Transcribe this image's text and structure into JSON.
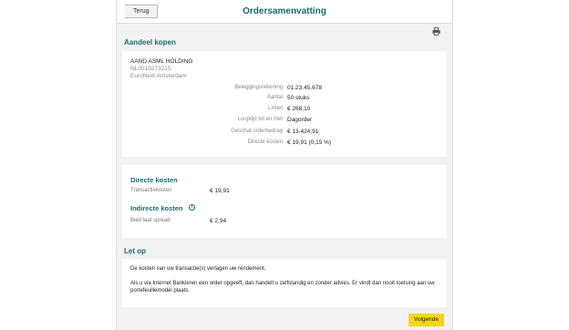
{
  "header": {
    "back_label": "Terug",
    "title": "Ordersamenvatting"
  },
  "icons": {
    "print": "print-icon",
    "info": "info-icon"
  },
  "order": {
    "section_title": "Aandeel kopen",
    "stock_name": "AAND ASML HOLDING",
    "isin": "NL0010273215",
    "exchange": "EuroNext Amsterdam",
    "details": [
      {
        "label": "Beleggingsrekening",
        "value": "01.23.45.678"
      },
      {
        "label": "Aantal",
        "value": "50 stuks"
      },
      {
        "label": "Limiet",
        "value": "€ 268,10"
      },
      {
        "label": "Looptijd tot en met",
        "value": "Dagorder"
      },
      {
        "label": "Geschat orderbedrag",
        "value": "€ 13.424,91"
      },
      {
        "label": "Directe kosten",
        "value": "€ 19,91 (0,15 %)"
      }
    ]
  },
  "costs": {
    "direct_title": "Directe kosten",
    "direct_label": "Transactiekosten",
    "direct_value": "€ 19,91",
    "indirect_title": "Indirecte kosten",
    "indirect_label": "Bied laat spread",
    "indirect_value": "€ 2,94"
  },
  "notice": {
    "title": "Let op",
    "paragraph1": "De kosten van uw transactie(s) verlagen uw rendement.",
    "paragraph2": "Als u via Internet Bankieren een order opgeeft, dan handelt u zelfstandig en zonder advies. Er vindt dan nooit toetsing aan uw portefeuillemodel plaats."
  },
  "footer": {
    "next_label": "Volgende"
  },
  "colors": {
    "accent": "#1c6b6c",
    "button": "#f5d519",
    "background": "#f2f2f2"
  }
}
